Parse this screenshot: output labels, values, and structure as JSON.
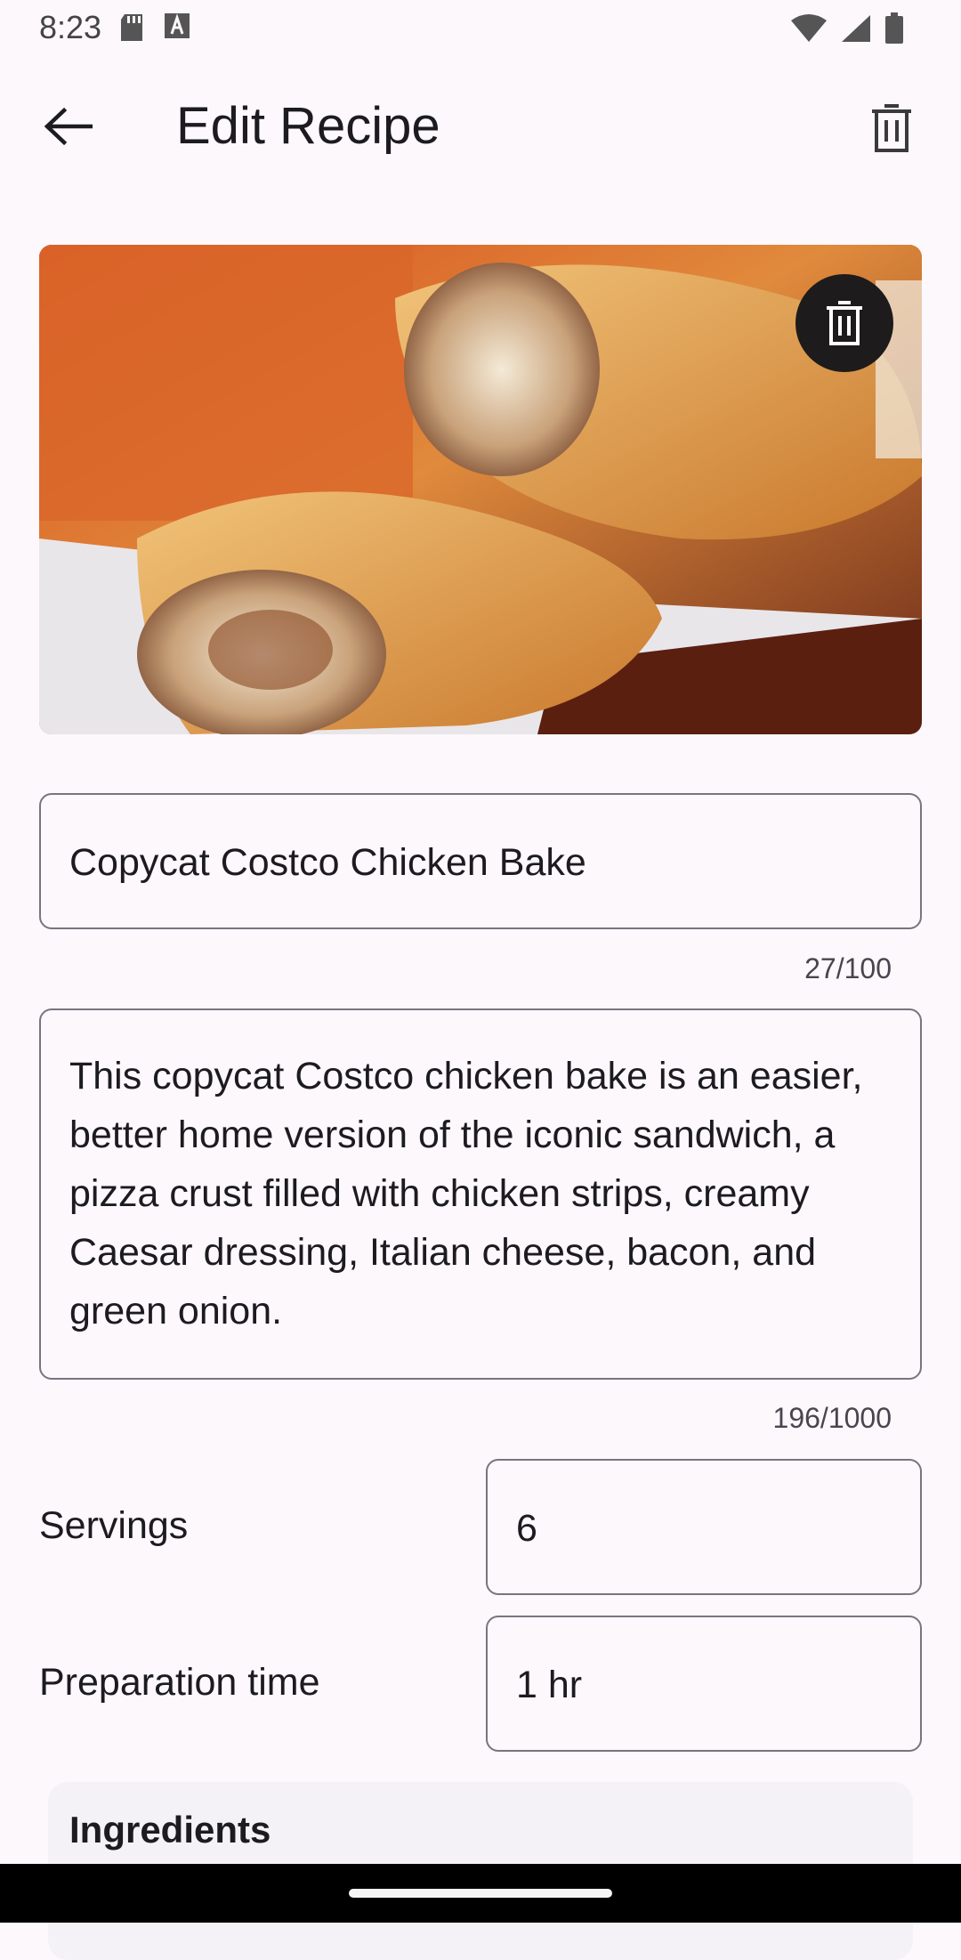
{
  "status": {
    "time": "8:23",
    "left_icons": [
      "sd-card-icon",
      "font-a-icon"
    ],
    "right_icons": [
      "wifi-icon",
      "signal-icon",
      "battery-icon"
    ]
  },
  "header": {
    "title": "Edit Recipe",
    "back_icon": "arrow-left-icon",
    "delete_icon": "trash-icon"
  },
  "image": {
    "alt_subject": "chicken bake pastry photo",
    "delete_icon": "trash-icon"
  },
  "form": {
    "name": {
      "value": "Copycat Costco Chicken Bake",
      "counter": "27/100"
    },
    "description": {
      "value": "This copycat Costco chicken bake is an easier, better home version of the iconic sandwich, a pizza crust filled with chicken strips, creamy Caesar dressing, Italian cheese, bacon, and green onion.",
      "counter": "196/1000"
    },
    "servings": {
      "label": "Servings",
      "value": "6"
    },
    "prep_time": {
      "label": "Preparation time",
      "value": "1 hr"
    }
  },
  "ingredients": {
    "title": "Ingredients"
  },
  "colors": {
    "background": "#fdf8fc",
    "outline": "#79747e",
    "card": "#f4f2f6",
    "fab": "#1d1b1c"
  }
}
